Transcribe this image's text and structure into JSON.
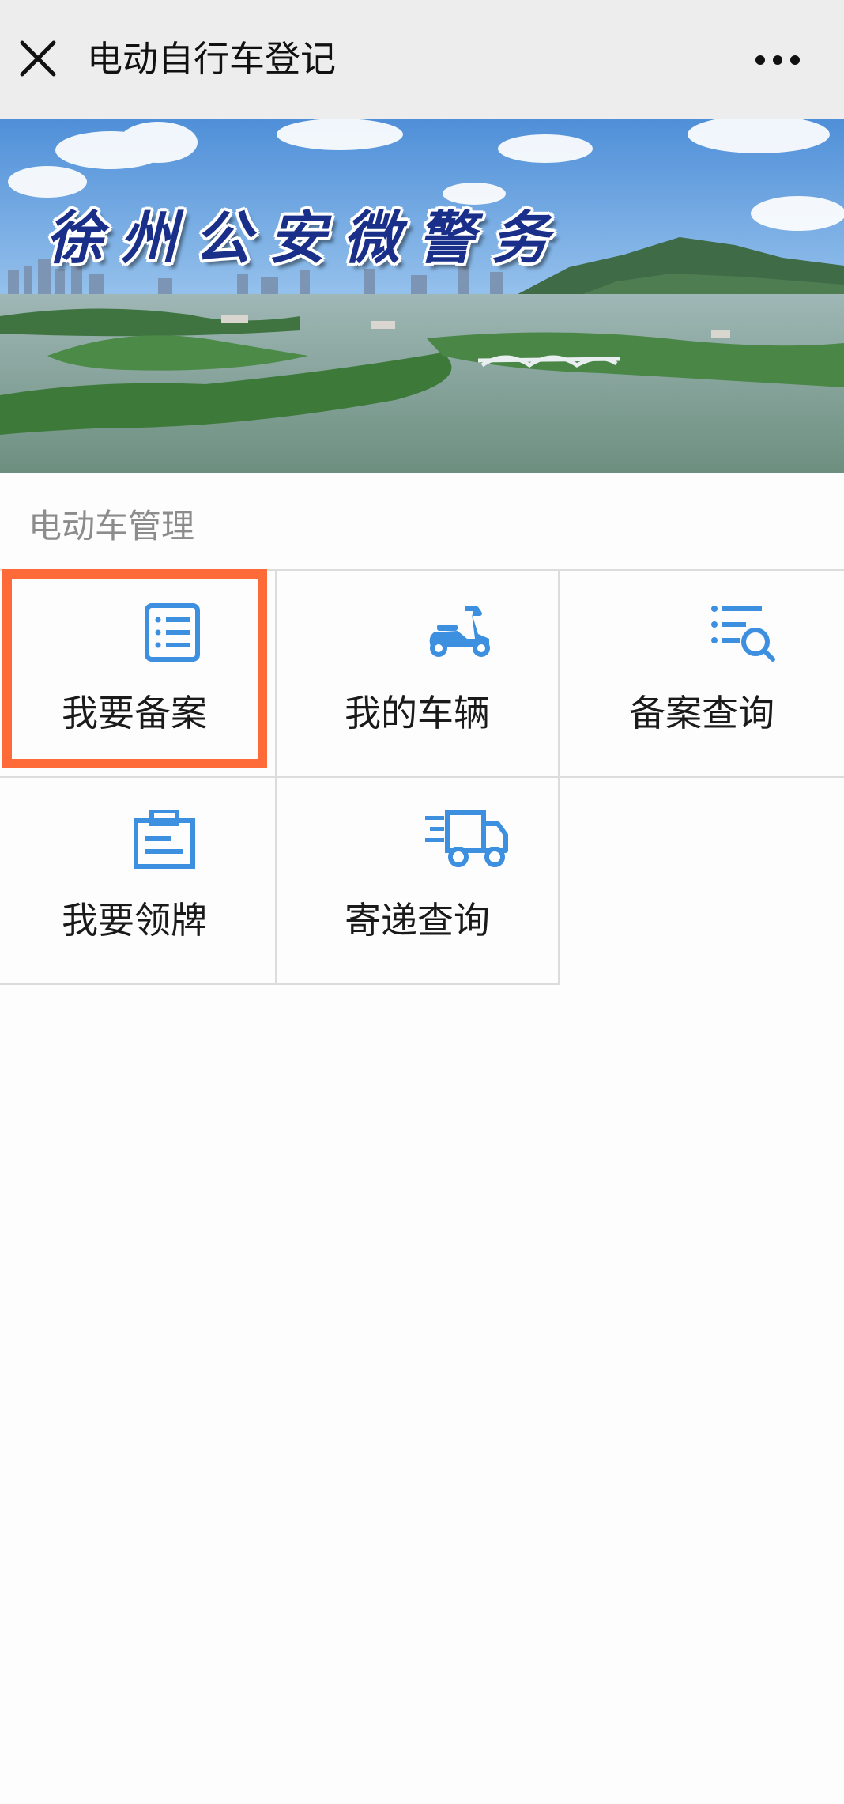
{
  "header": {
    "title": "电动自行车登记",
    "close_icon": "close-icon",
    "more_icon": "more-icon"
  },
  "banner": {
    "title": "徐州公安微警务"
  },
  "section": {
    "title": "电动车管理"
  },
  "menu": {
    "items": [
      {
        "label": "我要备案",
        "icon": "form-list-icon"
      },
      {
        "label": "我的车辆",
        "icon": "scooter-icon"
      },
      {
        "label": "备案查询",
        "icon": "list-search-icon"
      },
      {
        "label": "我要领牌",
        "icon": "id-card-icon"
      },
      {
        "label": "寄递查询",
        "icon": "delivery-truck-icon"
      }
    ]
  },
  "colors": {
    "accent_blue": "#3d8fe0",
    "highlight_orange": "#ff6a39",
    "header_bg": "#ededed",
    "page_bg": "#fdfdfd",
    "section_text": "#8c8c8c"
  }
}
